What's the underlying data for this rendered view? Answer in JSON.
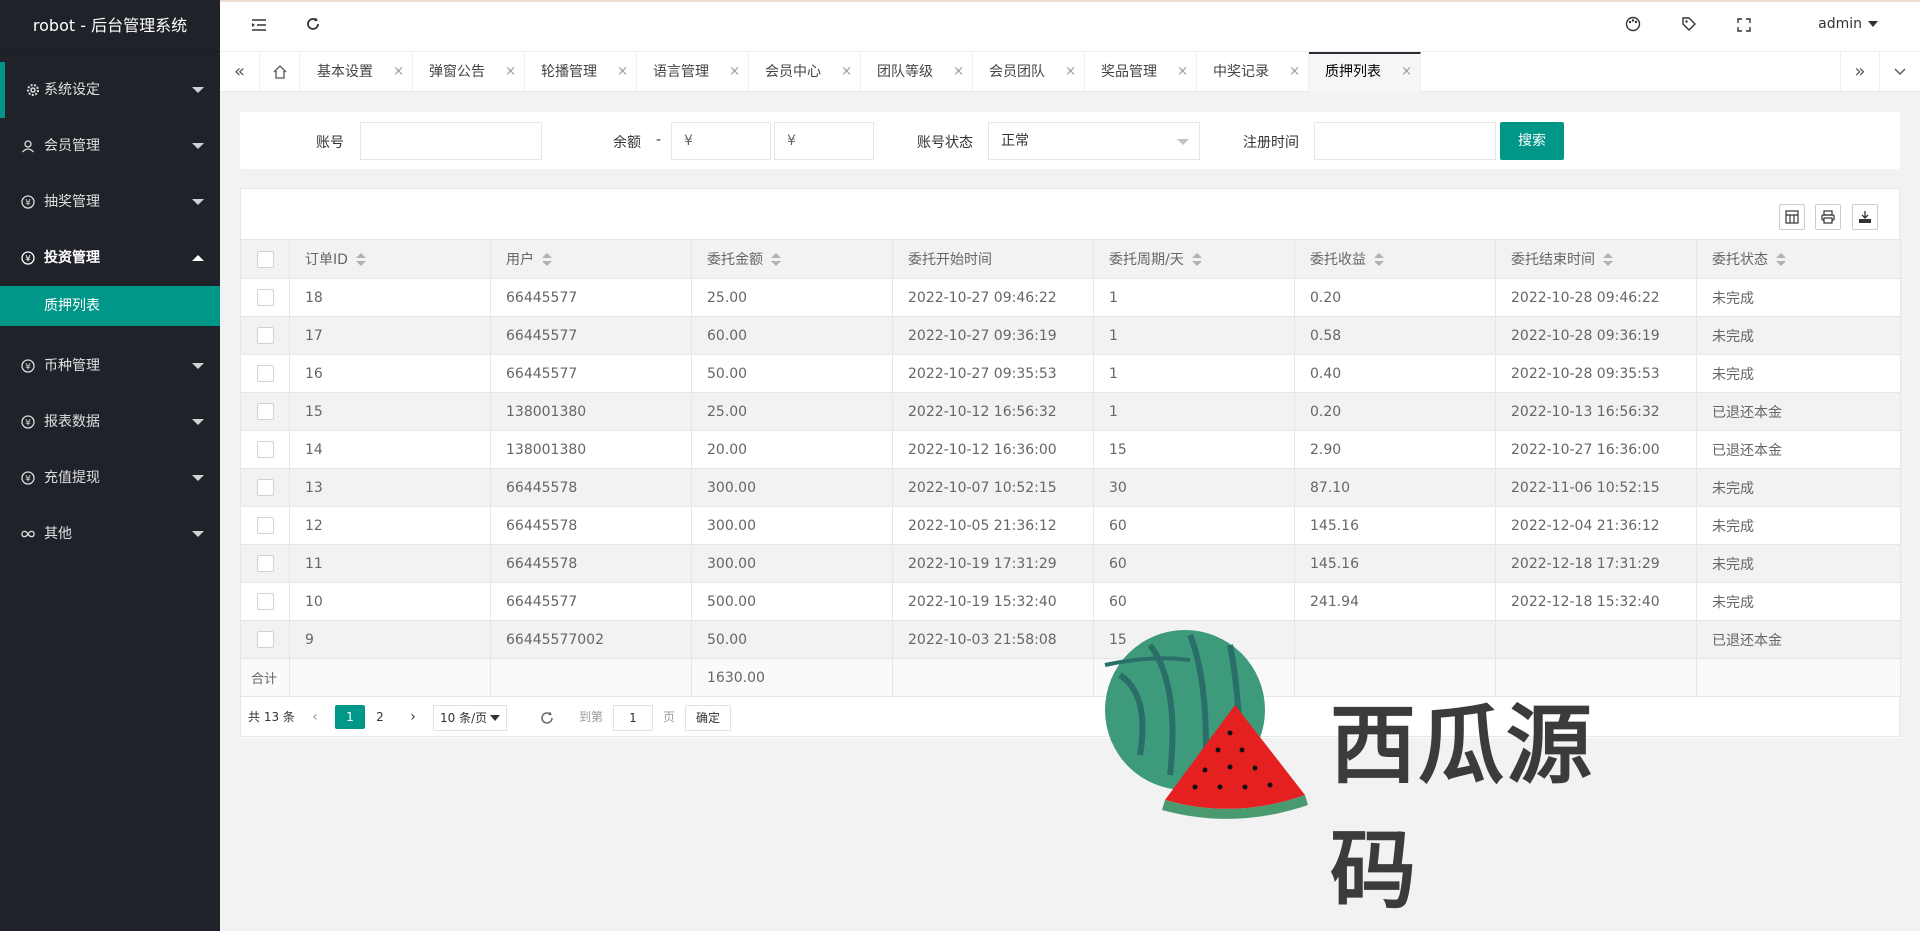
{
  "app": {
    "title": "robot - 后台管理系统"
  },
  "header": {
    "user": "admin"
  },
  "sidebar": {
    "items": [
      {
        "label": "系统设定",
        "icon": "gear-icon",
        "state": "collapsed"
      },
      {
        "label": "会员管理",
        "icon": "user-icon",
        "state": "collapsed"
      },
      {
        "label": "抽奖管理",
        "icon": "yen-circle-icon",
        "state": "collapsed"
      },
      {
        "label": "投资管理",
        "icon": "yen-circle-icon",
        "state": "expanded"
      },
      {
        "label": "币种管理",
        "icon": "yen-circle-icon",
        "state": "collapsed"
      },
      {
        "label": "报表数据",
        "icon": "yen-circle-icon",
        "state": "collapsed"
      },
      {
        "label": "充值提现",
        "icon": "yen-circle-icon",
        "state": "collapsed"
      },
      {
        "label": "其他",
        "icon": "infinity-icon",
        "state": "collapsed"
      }
    ],
    "subitem": "质押列表"
  },
  "tabs": [
    {
      "label": "基本设置"
    },
    {
      "label": "弹窗公告"
    },
    {
      "label": "轮播管理"
    },
    {
      "label": "语言管理"
    },
    {
      "label": "会员中心"
    },
    {
      "label": "团队等级"
    },
    {
      "label": "会员团队"
    },
    {
      "label": "奖品管理"
    },
    {
      "label": "中奖记录"
    },
    {
      "label": "质押列表",
      "active": true
    }
  ],
  "search": {
    "account_label": "账号",
    "account_value": "",
    "balance_label": "余额",
    "balance_dash": "-",
    "balance_min_placeholder": "¥",
    "balance_max_placeholder": "¥",
    "status_label": "账号状态",
    "status_value": "正常",
    "regtime_label": "注册时间",
    "regtime_value": "",
    "search_button": "搜索"
  },
  "table": {
    "columns": [
      "订单ID",
      "用户",
      "委托金额",
      "委托开始时间",
      "委托周期/天",
      "委托收益",
      "委托结束时间",
      "委托状态"
    ],
    "rows": [
      [
        "18",
        "66445577",
        "25.00",
        "2022-10-27 09:46:22",
        "1",
        "0.20",
        "2022-10-28 09:46:22",
        "未完成"
      ],
      [
        "17",
        "66445577",
        "60.00",
        "2022-10-27 09:36:19",
        "1",
        "0.58",
        "2022-10-28 09:36:19",
        "未完成"
      ],
      [
        "16",
        "66445577",
        "50.00",
        "2022-10-27 09:35:53",
        "1",
        "0.40",
        "2022-10-28 09:35:53",
        "未完成"
      ],
      [
        "15",
        "138001380",
        "25.00",
        "2022-10-12 16:56:32",
        "1",
        "0.20",
        "2022-10-13 16:56:32",
        "已退还本金"
      ],
      [
        "14",
        "138001380",
        "20.00",
        "2022-10-12 16:36:00",
        "15",
        "2.90",
        "2022-10-27 16:36:00",
        "已退还本金"
      ],
      [
        "13",
        "66445578",
        "300.00",
        "2022-10-07 10:52:15",
        "30",
        "87.10",
        "2022-11-06 10:52:15",
        "未完成"
      ],
      [
        "12",
        "66445578",
        "300.00",
        "2022-10-05 21:36:12",
        "60",
        "145.16",
        "2022-12-04 21:36:12",
        "未完成"
      ],
      [
        "11",
        "66445578",
        "300.00",
        "2022-10-19 17:31:29",
        "60",
        "145.16",
        "2022-12-18 17:31:29",
        "未完成"
      ],
      [
        "10",
        "66445577",
        "500.00",
        "2022-10-19 15:32:40",
        "60",
        "241.94",
        "2022-12-18 15:32:40",
        "未完成"
      ],
      [
        "9",
        "66445577002",
        "50.00",
        "2022-10-03 21:58:08",
        "15",
        "",
        "",
        "已退还本金"
      ]
    ],
    "footer": {
      "label": "合计",
      "amount_total": "1630.00"
    }
  },
  "pager": {
    "count": "共 13 条",
    "pages": [
      "1",
      "2"
    ],
    "current": "1",
    "page_size": "10 条/页",
    "goto_label": "到第",
    "goto_value": "1",
    "page_unit": "页",
    "confirm": "确定"
  },
  "watermark": {
    "text": "西瓜源码"
  }
}
